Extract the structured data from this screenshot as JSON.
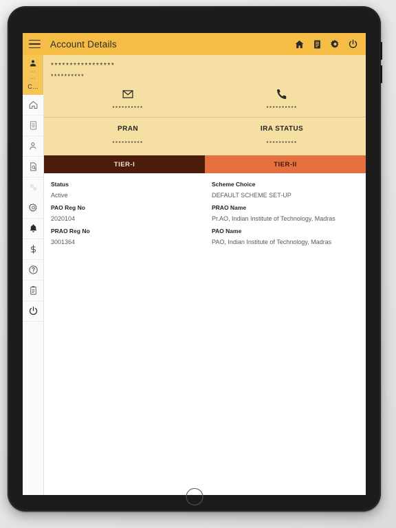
{
  "appbar": {
    "title": "Account Details",
    "menu_icon": "hamburger-icon",
    "actions": [
      {
        "name": "home-icon",
        "label": "Home"
      },
      {
        "name": "notes-icon",
        "label": "Statement"
      },
      {
        "name": "gear-icon",
        "label": "Settings"
      },
      {
        "name": "power-icon",
        "label": "Logout"
      }
    ]
  },
  "sidebar": {
    "profile": {
      "avatar_icon": "user-avatar-icon",
      "mask_line1": "···",
      "mask_line2": "···",
      "name": "C…"
    },
    "items": [
      {
        "name": "sidebar-item-home",
        "icon": "home-outline-icon",
        "disabled": false
      },
      {
        "name": "sidebar-item-statement",
        "icon": "document-outline-icon",
        "disabled": false
      },
      {
        "name": "sidebar-item-profile",
        "icon": "person-outline-icon",
        "disabled": false
      },
      {
        "name": "sidebar-item-document-search",
        "icon": "document-search-icon",
        "disabled": false
      },
      {
        "name": "sidebar-item-services",
        "icon": "double-gear-icon",
        "disabled": true
      },
      {
        "name": "sidebar-item-settings",
        "icon": "gear-outline-icon",
        "disabled": false
      },
      {
        "name": "sidebar-item-notifications",
        "icon": "bell-icon",
        "disabled": false
      },
      {
        "name": "sidebar-item-transactions",
        "icon": "dollar-icon",
        "disabled": false
      },
      {
        "name": "sidebar-item-help",
        "icon": "question-circle-icon",
        "disabled": false
      },
      {
        "name": "sidebar-item-clipboard",
        "icon": "clipboard-icon",
        "disabled": false
      },
      {
        "name": "sidebar-item-logout",
        "icon": "power-icon",
        "disabled": false
      }
    ]
  },
  "profile_panel": {
    "masked_name": "*****************",
    "masked_id": "**********",
    "email": {
      "icon": "envelope-icon",
      "masked_value": "**********"
    },
    "phone": {
      "icon": "phone-icon",
      "masked_value": "**********"
    }
  },
  "pran_panel": {
    "pran": {
      "label": "PRAN",
      "masked_value": "**********"
    },
    "ira_status": {
      "label": "IRA STATUS",
      "masked_value": "**********"
    }
  },
  "tabs": [
    {
      "label": "TIER-I",
      "active": true
    },
    {
      "label": "TIER-II",
      "active": false
    }
  ],
  "details": {
    "left": [
      {
        "label": "Status",
        "value": "Active"
      },
      {
        "label": "PAO Reg No",
        "value": "2020104"
      },
      {
        "label": "PRAO Reg No",
        "value": "3001364"
      }
    ],
    "right": [
      {
        "label": "Scheme Choice",
        "value": "DEFAULT SCHEME SET-UP"
      },
      {
        "label": "PRAO Name",
        "value": "Pr.AO, Indian Institute of Technology, Madras"
      },
      {
        "label": "PAO Name",
        "value": "PAO, Indian Institute of Technology, Madras"
      }
    ]
  },
  "device": {
    "home_button": "home-button",
    "volume_up": "volume-up-button",
    "volume_down": "volume-down-button"
  },
  "colors": {
    "appbar": "#f5bd45",
    "panel": "#f6dfa3",
    "tab_active": "#4a1c09",
    "tab_inactive": "#e5703f",
    "sidebar_profile": "#f5c455"
  }
}
